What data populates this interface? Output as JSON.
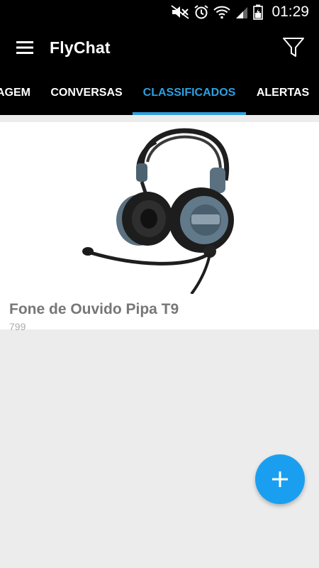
{
  "status_bar": {
    "time": "01:29",
    "icons": [
      "mute-icon",
      "alarm-icon",
      "wifi-icon",
      "signal-icon",
      "battery-icon"
    ]
  },
  "app_bar": {
    "title": "FlyChat",
    "menu_icon": "menu-icon",
    "filter_icon": "filter-icon"
  },
  "tabs": [
    {
      "label": "AGEM",
      "active": false
    },
    {
      "label": "CONVERSAS",
      "active": false
    },
    {
      "label": "CLASSIFICADOS",
      "active": true
    },
    {
      "label": "ALERTAS",
      "active": false
    }
  ],
  "colors": {
    "accent": "#2f9fdf",
    "fab": "#1a9ff0",
    "bar": "#000000",
    "background": "#ececec"
  },
  "listings": [
    {
      "title": "Fone de Ouvido Pipa T9",
      "price": "799",
      "image_icon": "headset-image"
    }
  ],
  "fab": {
    "icon": "plus-icon"
  }
}
